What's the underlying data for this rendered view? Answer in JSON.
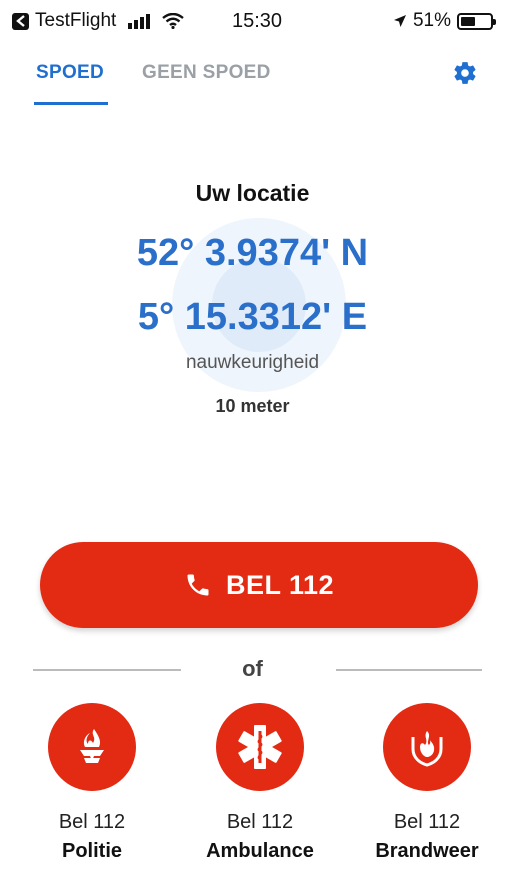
{
  "status_bar": {
    "back_app": "TestFlight",
    "time": "15:30",
    "battery_percent": "51%",
    "battery_level": 0.51
  },
  "tabs": [
    {
      "label": "SPOED",
      "active": true
    },
    {
      "label": "GEEN SPOED",
      "active": false
    }
  ],
  "icons": {
    "settings": "gear-icon",
    "call": "phone-icon",
    "police": "police-badge-icon",
    "ambulance": "star-of-life-icon",
    "fire": "fire-brigade-icon"
  },
  "location": {
    "title": "Uw locatie",
    "latitude": "52° 3.9374' N",
    "longitude": "5° 15.3312' E",
    "accuracy_label": "nauwkeurigheid",
    "accuracy_value": "10 meter"
  },
  "call_button": {
    "label": "BEL 112"
  },
  "divider": {
    "text": "of"
  },
  "services": [
    {
      "line1": "Bel 112",
      "line2": "Politie"
    },
    {
      "line1": "Bel 112",
      "line2": "Ambulance"
    },
    {
      "line1": "Bel 112",
      "line2": "Brandweer"
    }
  ],
  "colors": {
    "accent_blue": "#1f6fd0",
    "emergency_red": "#e32a13",
    "inactive_tab": "#9aa0a6"
  }
}
